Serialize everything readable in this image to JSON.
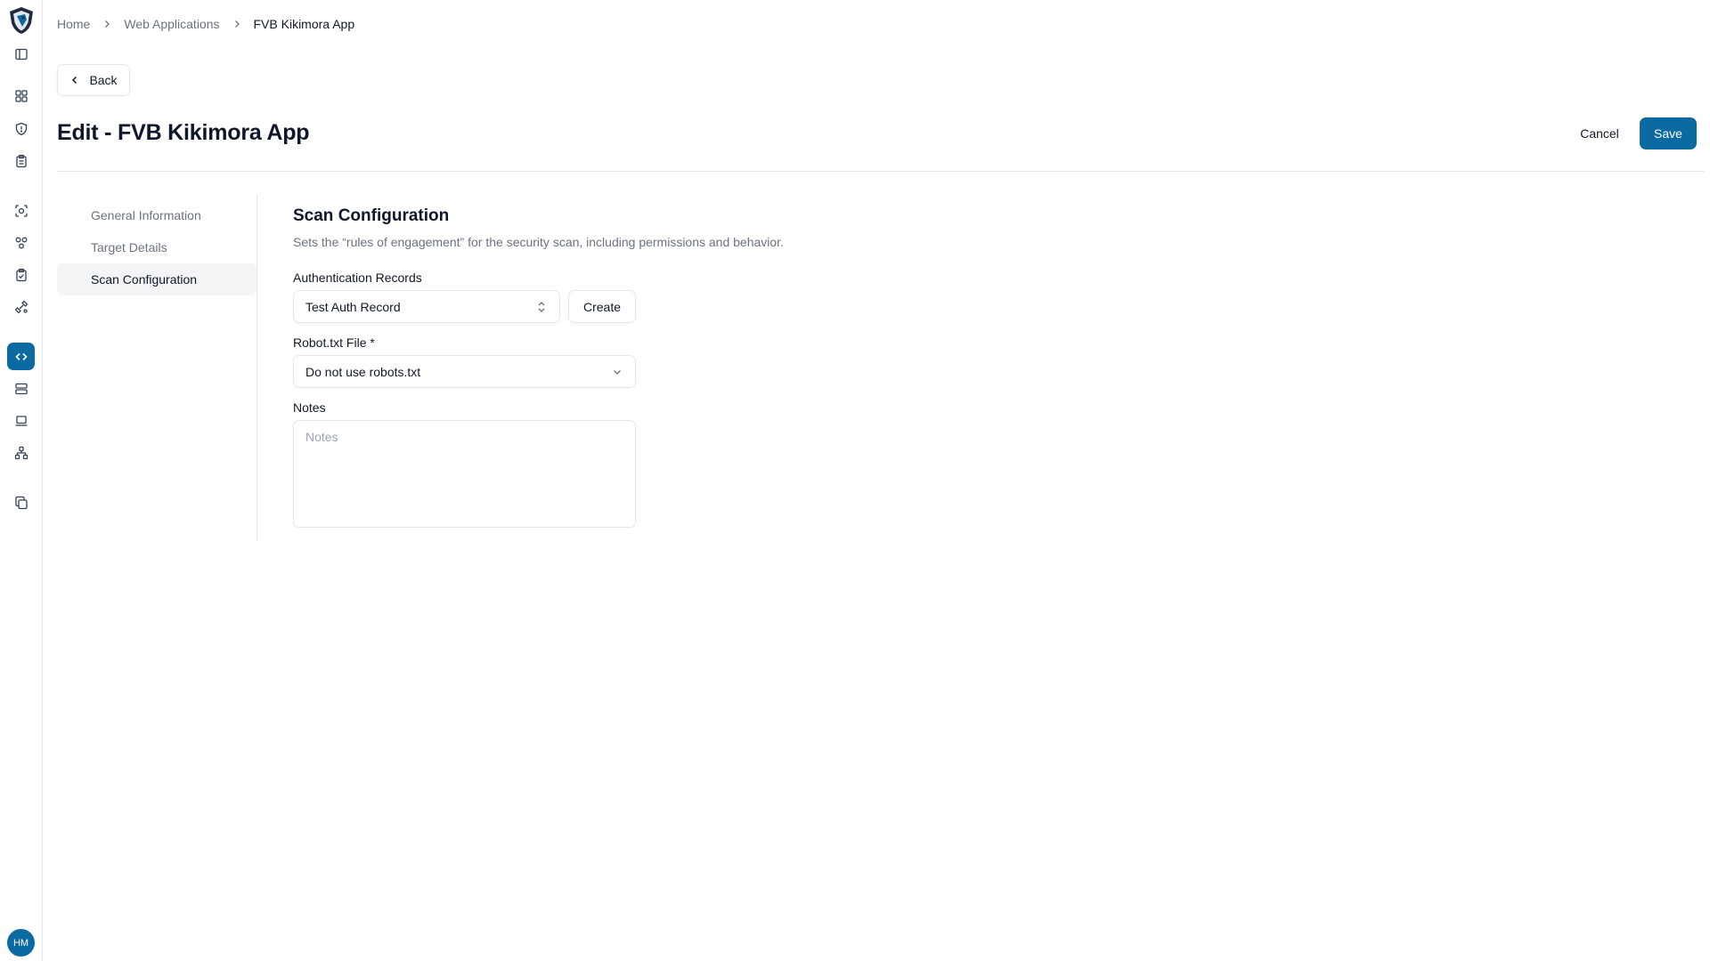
{
  "breadcrumb": {
    "items": [
      "Home",
      "Web Applications"
    ],
    "current": "FVB Kikimora App"
  },
  "back_label": "Back",
  "page_title": "Edit - FVB Kikimora App",
  "actions": {
    "cancel": "Cancel",
    "save": "Save"
  },
  "subnav": {
    "items": [
      "General Information",
      "Target Details",
      "Scan Configuration"
    ],
    "active_index": 2
  },
  "section": {
    "title": "Scan Configuration",
    "description": "Sets the “rules of engagement” for the security scan, including permissions and behavior."
  },
  "fields": {
    "auth_records": {
      "label": "Authentication Records",
      "value": "Test Auth Record",
      "create_label": "Create"
    },
    "robots": {
      "label": "Robot.txt File *",
      "value": "Do not use robots.txt"
    },
    "notes": {
      "label": "Notes",
      "placeholder": "Notes",
      "value": ""
    }
  },
  "user": {
    "initials": "HM"
  },
  "theme": {
    "accent": "#0b6aa2"
  },
  "sidebar_icons": [
    "panel-toggle-icon",
    "dashboard-icon",
    "shield-icon",
    "clipboard-icon",
    "scan-icon",
    "assets-icon",
    "clipboard-check-icon",
    "integrations-icon",
    "code-icon",
    "servers-icon",
    "laptop-icon",
    "network-icon",
    "copy-icon"
  ]
}
